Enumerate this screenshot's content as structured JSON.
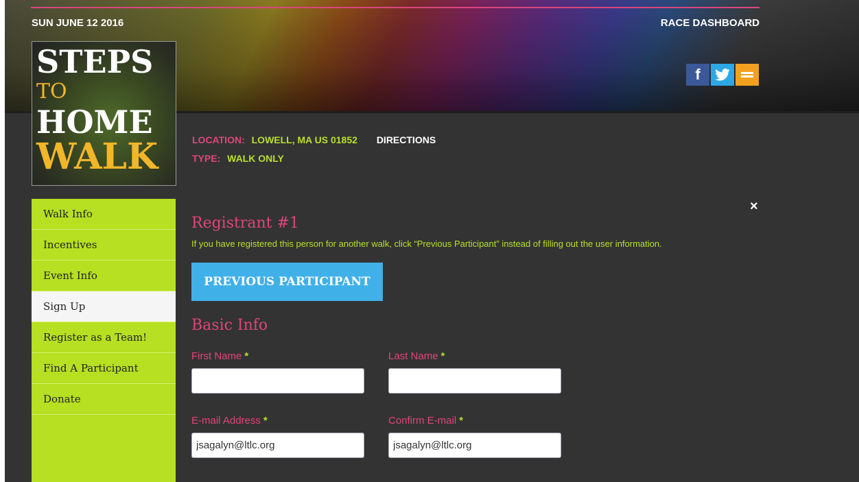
{
  "header": {
    "date": "SUN JUNE 12 2016",
    "race_dashboard": "RACE DASHBOARD",
    "social": [
      {
        "name": "facebook-icon",
        "glyph": "f"
      },
      {
        "name": "twitter-icon",
        "glyph": "🐦"
      },
      {
        "name": "email-icon",
        "glyph": "="
      }
    ]
  },
  "logo": {
    "line1": "STEPS",
    "line2": "TO",
    "line3": "HOME",
    "line4": "WALK"
  },
  "event": {
    "location_label": "LOCATION:",
    "location_value": "LOWELL, MA US 01852",
    "directions": "DIRECTIONS",
    "type_label": "TYPE:",
    "type_value": "WALK ONLY"
  },
  "sidebar": {
    "items": [
      {
        "label": "Walk Info",
        "active": false
      },
      {
        "label": "Incentives",
        "active": false
      },
      {
        "label": "Event Info",
        "active": false
      },
      {
        "label": "Sign Up",
        "active": true
      },
      {
        "label": "Register as a Team!",
        "active": false
      },
      {
        "label": "Find A Participant",
        "active": false
      },
      {
        "label": "Donate",
        "active": false
      }
    ]
  },
  "main": {
    "close": "×",
    "registrant_title": "Registrant #1",
    "registrant_note": "If you have registered this person for another walk, click “Previous Participant” instead of filling out the user information.",
    "previous_participant": "PREVIOUS PARTICIPANT",
    "basic_info_title": "Basic Info",
    "fields": {
      "first_name_label": "First Name",
      "first_name_value": "",
      "last_name_label": "Last Name",
      "last_name_value": "",
      "email_label": "E-mail Address",
      "email_value": "jsagalyn@ltlc.org",
      "confirm_email_label": "Confirm E-mail",
      "confirm_email_value": "jsagalyn@ltlc.org",
      "required_mark": "*"
    }
  },
  "colors": {
    "accent_pink": "#e0457b",
    "accent_green": "#b9e02a",
    "button_blue": "#40b0e8",
    "sidebar_green": "#b6e021",
    "background": "#333333"
  }
}
